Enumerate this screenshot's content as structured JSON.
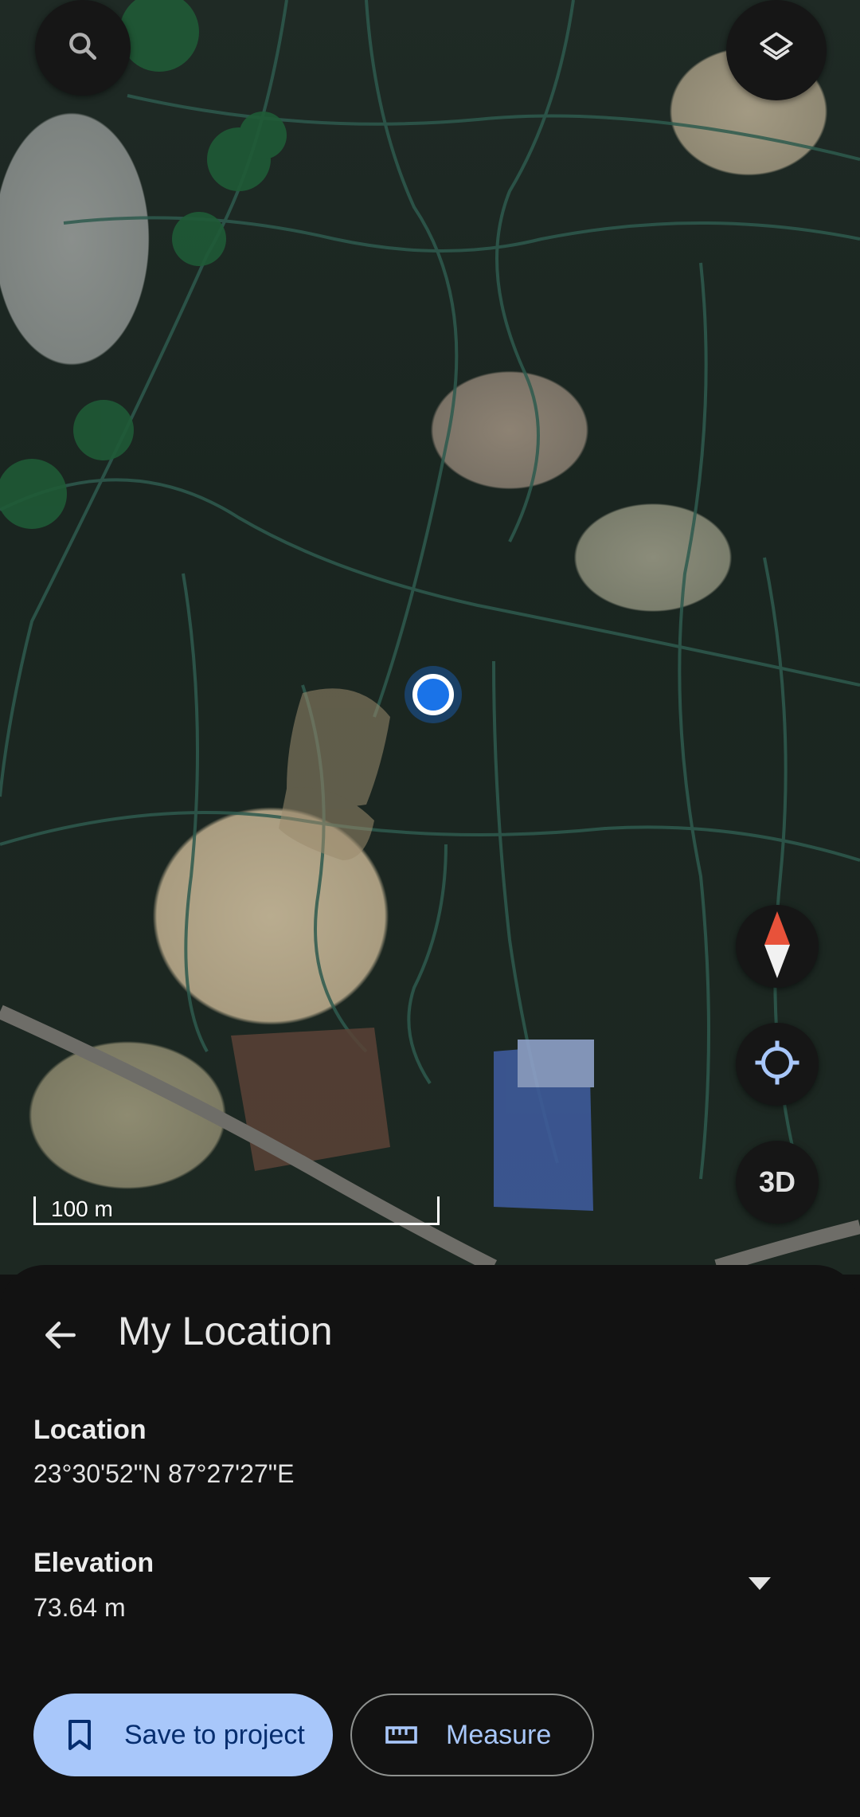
{
  "map": {
    "scale_label": "100 m",
    "threed_label": "3D",
    "pin_color": "#1a73e8",
    "icons": [
      "search-icon",
      "layers-icon",
      "compass-icon",
      "my-location-icon"
    ]
  },
  "sheet": {
    "title": "My Location",
    "location": {
      "label": "Location",
      "value": "23°30'52\"N 87°27'27\"E"
    },
    "elevation": {
      "label": "Elevation",
      "value": "73.64 m"
    },
    "buttons": {
      "save_label": "Save to project",
      "measure_label": "Measure"
    },
    "accent_color": "#a8c7fa"
  }
}
